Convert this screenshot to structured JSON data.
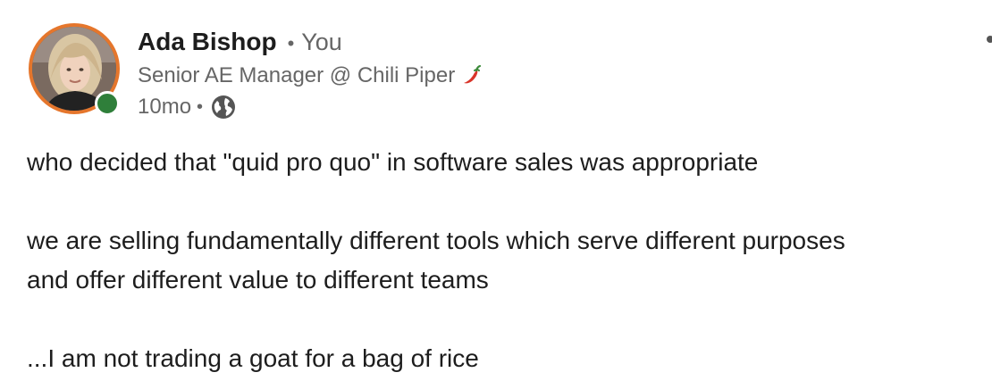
{
  "author": {
    "name": "Ada Bishop",
    "separator": "•",
    "relation": "You",
    "headline": "Senior AE Manager @ Chili Piper",
    "headline_emoji_icon": "chili-pepper-icon",
    "time_ago": "10mo",
    "meta_separator": "•",
    "visibility_icon": "globe-icon",
    "presence": "online",
    "avatar_border_color": "#e5762c",
    "presence_color": "#2f7f3a"
  },
  "post": {
    "paragraphs": [
      [
        "who decided that \"quid pro quo\" in software sales was appropriate"
      ],
      [
        "we are selling fundamentally different tools which serve different purposes",
        "and offer different value to different teams"
      ],
      [
        "...I am not trading a goat for a bag of rice"
      ]
    ]
  },
  "menu": {
    "icon": "more-options-icon"
  }
}
